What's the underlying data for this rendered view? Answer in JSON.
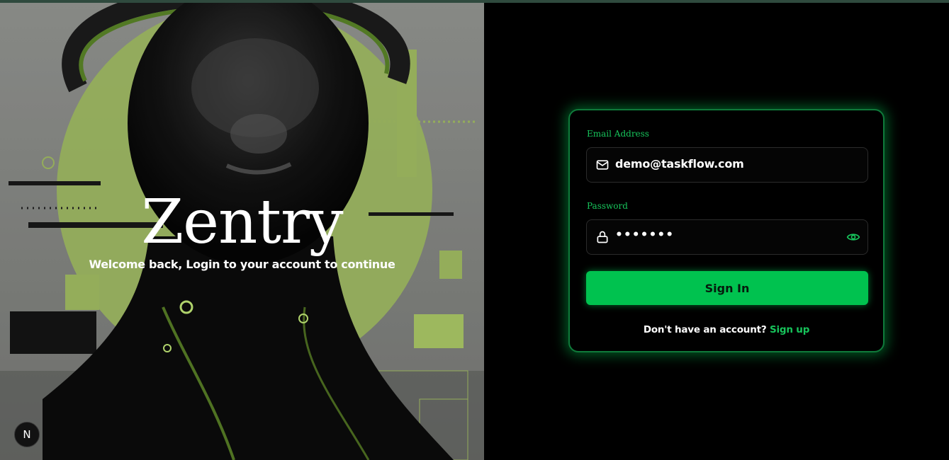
{
  "hero": {
    "brand": "Zentry",
    "tagline": "Welcome back, Login to your account to continue",
    "badge": "N"
  },
  "form": {
    "email_label": "Email Address",
    "email_value": "demo@taskflow.com",
    "password_label": "Password",
    "password_value": "•••••••",
    "submit_label": "Sign In",
    "footer_text": "Don't have an account?",
    "footer_link": "Sign up"
  },
  "icons": {
    "email": "mail-icon",
    "password": "lock-icon",
    "toggle": "eye-icon"
  },
  "colors": {
    "accent": "#00c24f",
    "accent_text": "#17c45b",
    "background": "#000000",
    "hero_lime": "#b3d26c"
  }
}
